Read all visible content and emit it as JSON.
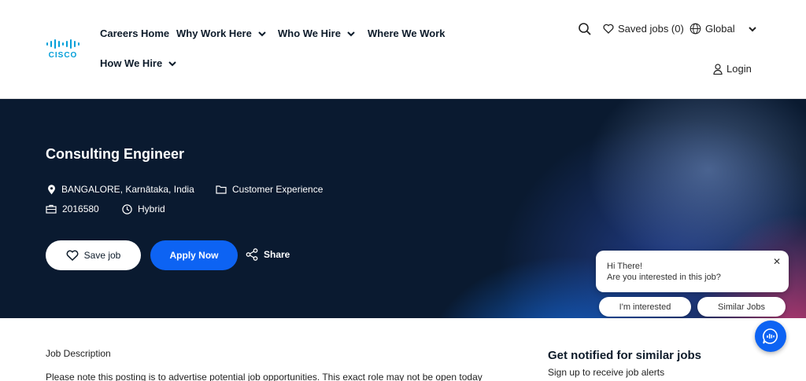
{
  "brand": {
    "logo_text": "CISCO",
    "accent": "#049fd9"
  },
  "nav": {
    "careers_home": "Careers Home",
    "why_work_here": "Why Work Here",
    "who_we_hire": "Who We Hire",
    "where_we_work": "Where We Work",
    "how_we_hire": "How We Hire"
  },
  "utility": {
    "saved_jobs": "Saved jobs (0)",
    "region": "Global",
    "login": "Login"
  },
  "job": {
    "title": "Consulting Engineer",
    "location": "BANGALORE, Karnātaka, India",
    "category": "Customer Experience",
    "job_id": "2016580",
    "work_type": "Hybrid"
  },
  "actions": {
    "save": "Save job",
    "apply": "Apply Now",
    "share": "Share",
    "apply_color": "#0d63f3"
  },
  "chat": {
    "greeting": "Hi There!",
    "question": "Are you interested in this job?",
    "close": "✕",
    "interested": "I'm interested",
    "similar": "Similar Jobs"
  },
  "content": {
    "jd_label": "Job Description",
    "jd_text": "Please note this posting is to advertise potential job opportunities. This exact role may not be open today",
    "notify_title": "Get notified for similar jobs",
    "notify_sub": "Sign up to receive job alerts"
  }
}
